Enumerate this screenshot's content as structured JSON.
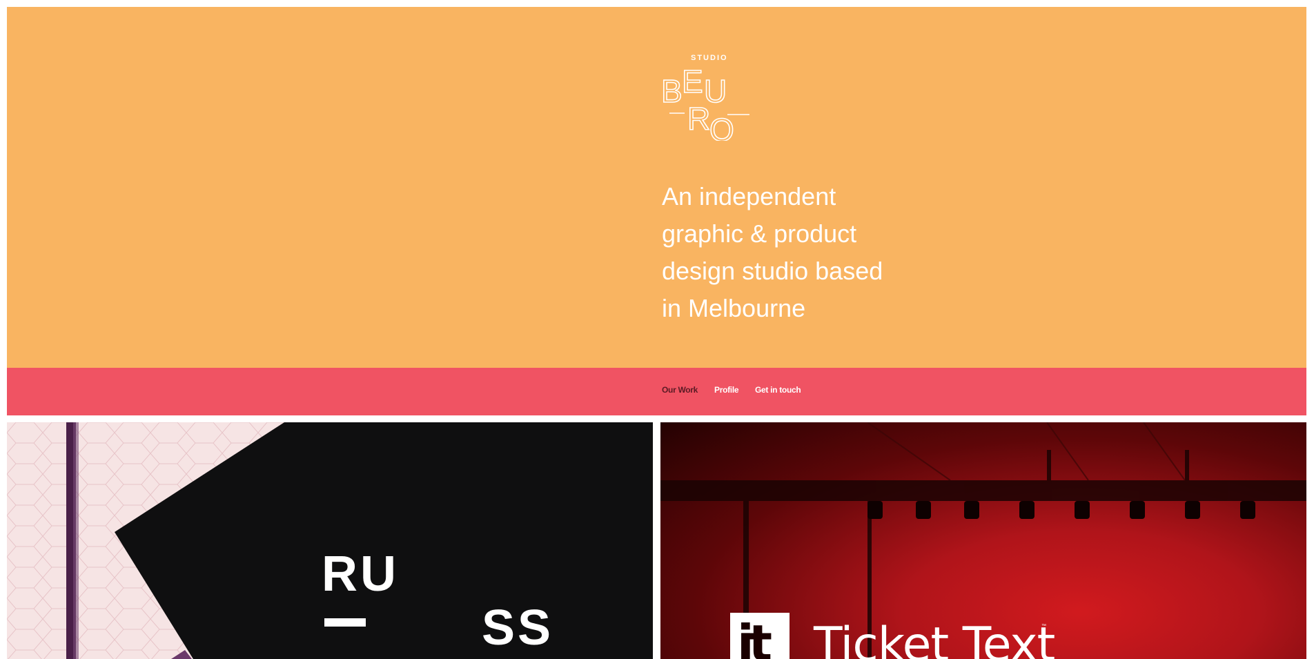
{
  "brand": {
    "studio_label": "STUDIO",
    "logo_letters": [
      "B",
      "E",
      "U",
      "R",
      "O"
    ]
  },
  "hero": {
    "tagline_lines": [
      "An independent",
      "graphic & product",
      "design studio based",
      "in Melbourne"
    ]
  },
  "nav": {
    "items": [
      {
        "label": "Our Work",
        "active": true
      },
      {
        "label": "Profile",
        "active": false
      },
      {
        "label": "Get in touch",
        "active": false
      }
    ]
  },
  "work": {
    "tiles": [
      {
        "logo_text": [
          "RU",
          "SS",
          "—"
        ]
      },
      {
        "logo_mark": "jt",
        "title": "Ticket Text",
        "trademark": "™"
      }
    ]
  },
  "colors": {
    "hero_bg": "#f9b461",
    "nav_bg": "#f05363",
    "nav_active_text": "#5a1a24",
    "text_light": "#ffffff"
  }
}
